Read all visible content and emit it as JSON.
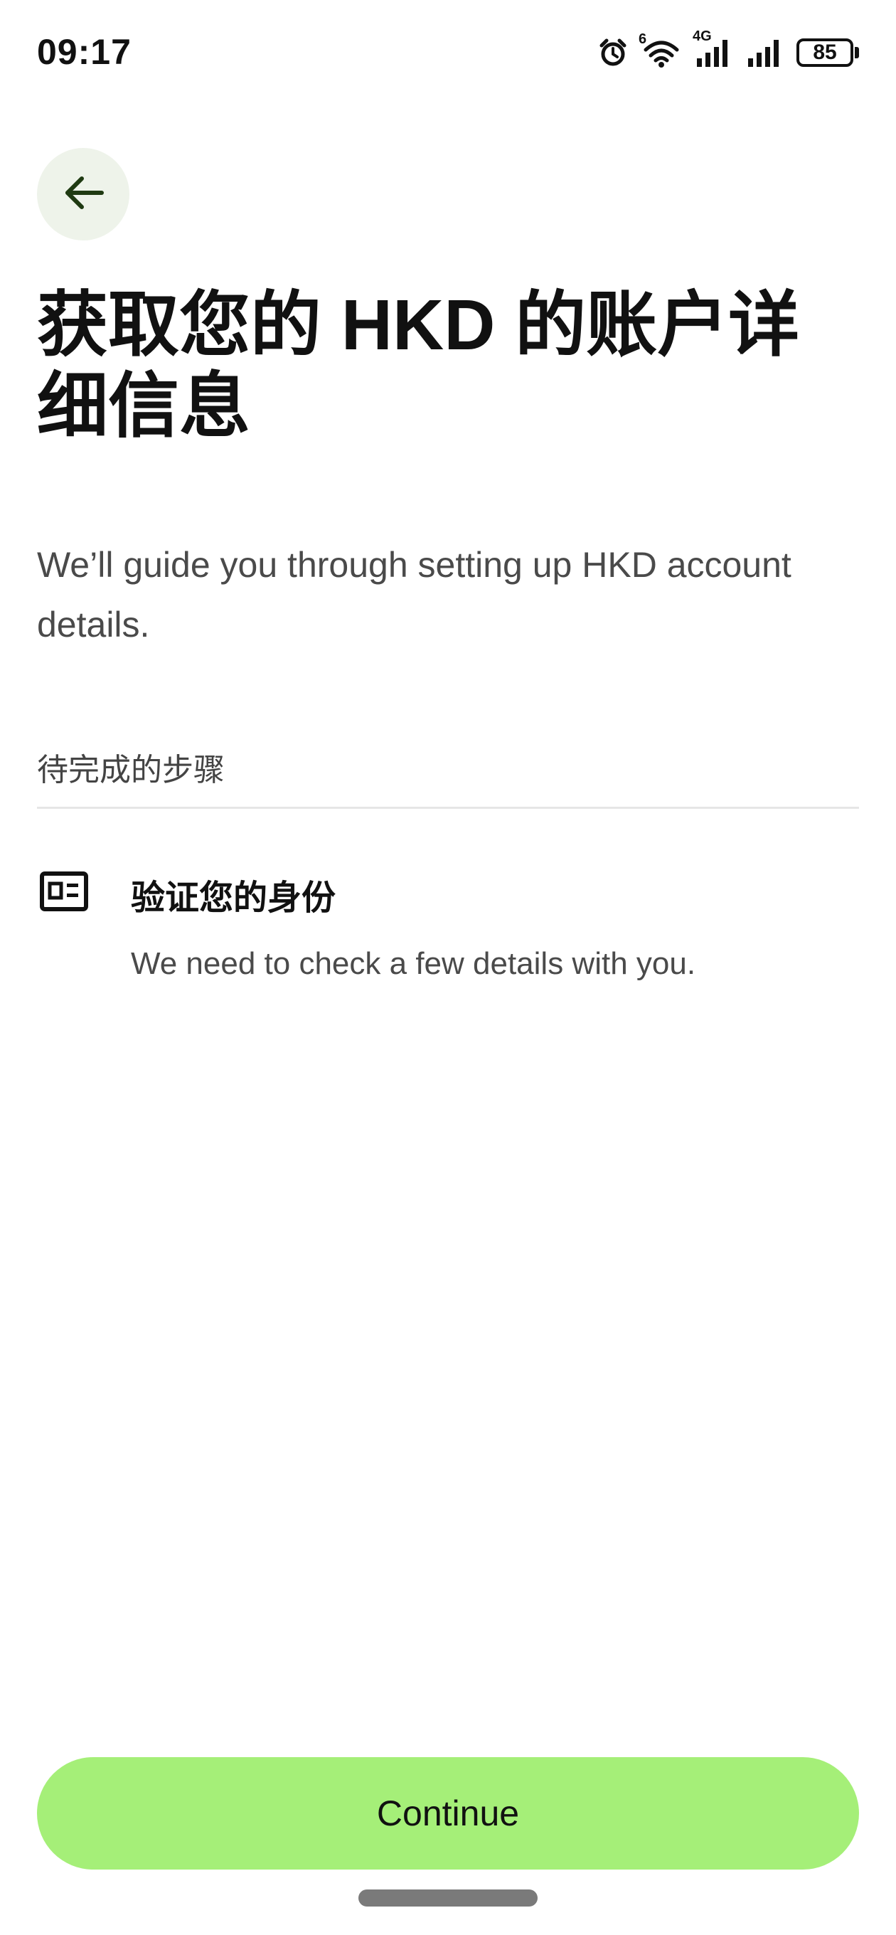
{
  "status_bar": {
    "time": "09:17",
    "network_label": "4G",
    "wifi_badge": "6",
    "battery_level": "85",
    "icons": [
      "alarm-icon",
      "wifi-icon",
      "cellular-4g-icon",
      "cellular-signal-icon",
      "battery-icon"
    ]
  },
  "header": {
    "back_icon": "arrow-left-icon"
  },
  "page": {
    "title": "获取您的 HKD 的账户详细信息",
    "description": "We’ll guide you through setting up HKD account details."
  },
  "steps_section": {
    "label": "待完成的步骤",
    "steps": [
      {
        "icon": "id-card-icon",
        "title": "验证您的身份",
        "description": "We need to check a few details with you."
      }
    ]
  },
  "footer": {
    "continue_label": "Continue"
  },
  "colors": {
    "accent": "#a5ef78",
    "back_button_bg": "#eef3ea",
    "text_primary": "#111111",
    "text_secondary": "#4a4a4a"
  }
}
